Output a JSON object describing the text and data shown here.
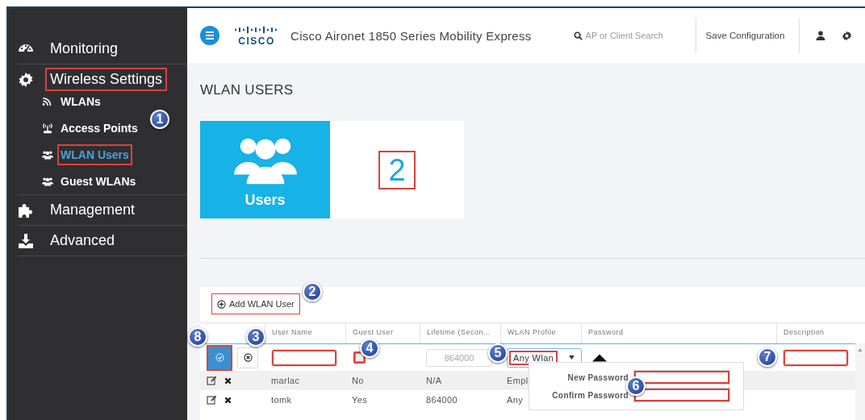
{
  "sidebar": {
    "items": [
      {
        "label": "Monitoring",
        "selected": false,
        "outlined": false
      },
      {
        "label": "Wireless Settings",
        "selected": false,
        "outlined": true,
        "children": [
          {
            "label": "WLANs",
            "selected": false,
            "outlined": false
          },
          {
            "label": "Access Points",
            "selected": false,
            "outlined": false
          },
          {
            "label": "WLAN Users",
            "selected": true,
            "outlined": true
          },
          {
            "label": "Guest WLANs",
            "selected": false,
            "outlined": false
          }
        ]
      },
      {
        "label": "Management",
        "selected": false,
        "outlined": false
      },
      {
        "label": "Advanced",
        "selected": false,
        "outlined": false
      }
    ]
  },
  "header": {
    "logo": "CISCO",
    "title": "Cisco Aironet 1850 Series Mobility Express",
    "search": {
      "placeholder": "AP or Client Search"
    },
    "save_button": "Save Configuration"
  },
  "page_title": "WLAN USERS",
  "tile": {
    "label": "Users",
    "count": "2",
    "outlined": true
  },
  "add_button": {
    "label": "Add WLAN User",
    "outlined": true
  },
  "table": {
    "columns": [
      "User Name",
      "Guest User",
      "Lifetime (Secon...",
      "WLAN Profile",
      "Password",
      "Description"
    ],
    "edit_row": {
      "save_outlined": true,
      "user_name_outlined": true,
      "guest_checked": false,
      "guest_outlined": true,
      "lifetime_placeholder": "864000",
      "wlan_profile": "Any Wlan",
      "wlan_profile_outlined": true,
      "description_outlined": true
    },
    "rows": [
      {
        "user_name": "marlac",
        "guest_user": "No",
        "lifetime": "N/A",
        "wlan_profile": "Empl"
      },
      {
        "user_name": "tomk",
        "guest_user": "Yes",
        "lifetime": "864000",
        "wlan_profile": "Any"
      }
    ]
  },
  "password_popup": {
    "fields": [
      {
        "label": "New Password",
        "outlined": true
      },
      {
        "label": "Confirm Password",
        "outlined": true
      }
    ]
  },
  "callouts": [
    {
      "label": "1"
    },
    {
      "label": "2"
    },
    {
      "label": "3"
    },
    {
      "label": "4"
    },
    {
      "label": "5"
    },
    {
      "label": "6"
    },
    {
      "label": "7"
    },
    {
      "label": "8"
    }
  ]
}
